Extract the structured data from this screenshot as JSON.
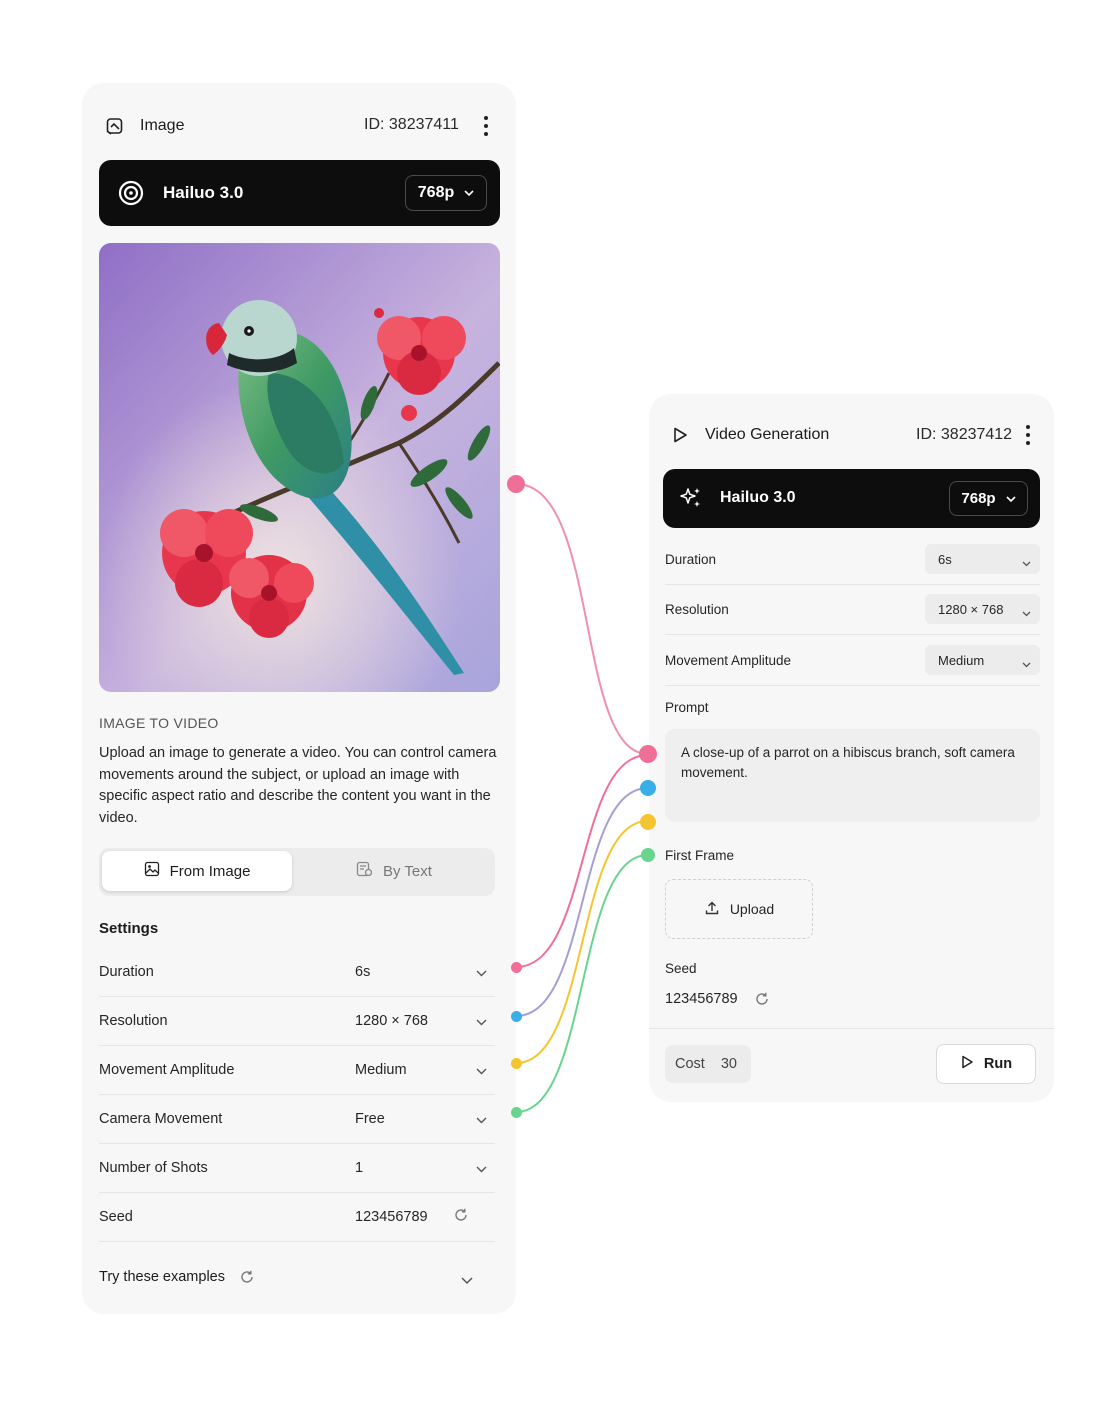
{
  "image_node": {
    "title": "Image",
    "id_label": "ID: 38237411",
    "model": "Hailuo 3.0",
    "resolution": "768p",
    "section_kicker": "IMAGE TO VIDEO",
    "description": "Upload an image to generate a video. You can control camera movements around the subject, or upload an image with specific aspect ratio and describe the content you want in the video.",
    "tabs": [
      {
        "label": "From Image",
        "active": true
      },
      {
        "label": "By Text",
        "active": false
      }
    ],
    "settings_title": "Settings",
    "settings": [
      {
        "label": "Duration",
        "value": "6s"
      },
      {
        "label": "Resolution",
        "value": "1280 × 768"
      },
      {
        "label": "Movement Amplitude",
        "value": "Medium"
      },
      {
        "label": "Camera Movement",
        "value": "Free"
      },
      {
        "label": "Number of Shots",
        "value": "1"
      },
      {
        "label": "Seed",
        "value": "123456789"
      }
    ],
    "examples_label": "Try these examples"
  },
  "video_node": {
    "title": "Video Generation",
    "id_label": "ID: 38237412",
    "model": "Hailuo 3.0",
    "resolution": "768p",
    "params": [
      {
        "label": "Duration",
        "value": "6s"
      },
      {
        "label": "Resolution",
        "value": "1280 × 768"
      },
      {
        "label": "Movement Amplitude",
        "value": "Medium"
      }
    ],
    "prompt_label": "Prompt",
    "prompt_text": "A close-up of a parrot on a hibiscus branch, soft camera movement.",
    "first_frame_label": "First Frame",
    "upload_label": "Upload",
    "seed_label": "Seed",
    "seed_value": "123456789",
    "cost_label": "Cost",
    "cost_value": "30",
    "run_label": "Run"
  },
  "colors": {
    "pink": "#f06f97",
    "blue": "#3aaee6",
    "yellow": "#f3c531",
    "green": "#69d48d",
    "purple_wire": "#a59fd4"
  },
  "icons": [
    "image-node-icon",
    "spiral-logo-icon",
    "chevron-down-icon",
    "kebab-menu-icon",
    "image-icon",
    "text-image-icon",
    "refresh-icon",
    "play-icon",
    "sparkles-icon",
    "upload-icon"
  ]
}
